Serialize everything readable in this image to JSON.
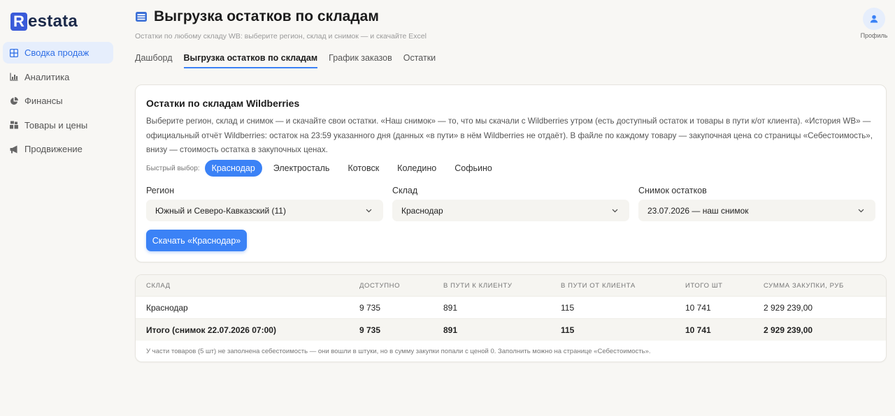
{
  "app": {
    "logo_letter": "R",
    "logo_rest": "estata"
  },
  "sidebar": {
    "items": [
      {
        "label": "Сводка продаж",
        "icon": "grid-icon",
        "active": true
      },
      {
        "label": "Аналитика",
        "icon": "bar-chart-icon",
        "active": false
      },
      {
        "label": "Финансы",
        "icon": "pie-chart-icon",
        "active": false
      },
      {
        "label": "Товары и цены",
        "icon": "boxes-icon",
        "active": false
      },
      {
        "label": "Продвижение",
        "icon": "megaphone-icon",
        "active": false
      }
    ]
  },
  "header": {
    "title": "Выгрузка остатков по складам",
    "subtitle": "Остатки по любому складу WB: выберите регион, склад и снимок — и скачайте Excel",
    "profile_label": "Профиль"
  },
  "tabs": [
    {
      "label": "Дашборд",
      "active": false
    },
    {
      "label": "Выгрузка остатков по складам",
      "active": true
    },
    {
      "label": "График заказов",
      "active": false
    },
    {
      "label": "Остатки",
      "active": false
    }
  ],
  "form": {
    "title": "Остатки по складам Wildberries",
    "description": "Выберите регион, склад и снимок — и скачайте свои остатки. «Наш снимок» — то, что мы скачали с Wildberries утром (есть доступный остаток и товары в пути к/от клиента). «История WB» — официальный отчёт Wildberries: остаток на 23:59 указанного дня (данных «в пути» в нём Wildberries не отдаёт). В файле по каждому товару — закупочная цена со страницы «Себестоимость», внизу — стоимость остатка в закупочных ценах.",
    "quick_label": "Быстрый выбор:",
    "quick_chips": [
      {
        "label": "Краснодар",
        "active": true
      },
      {
        "label": "Электросталь",
        "active": false
      },
      {
        "label": "Котовск",
        "active": false
      },
      {
        "label": "Коледино",
        "active": false
      },
      {
        "label": "Софьино",
        "active": false
      }
    ],
    "region_label": "Регион",
    "region_value": "Южный и Северо-Кавказский (11)",
    "warehouse_label": "Склад",
    "warehouse_value": "Краснодар",
    "snapshot_label": "Снимок остатков",
    "snapshot_value": "23.07.2026 — наш снимок",
    "download_button": "Скачать «Краснодар»"
  },
  "table": {
    "columns": [
      "СКЛАД",
      "ДОСТУПНО",
      "В ПУТИ К КЛИЕНТУ",
      "В ПУТИ ОТ КЛИЕНТА",
      "ИТОГО ШТ",
      "СУММА ЗАКУПКИ, РУБ"
    ],
    "rows": [
      [
        "Краснодар",
        "9 735",
        "891",
        "115",
        "10 741",
        "2 929 239,00"
      ]
    ],
    "total": [
      "Итого (снимок 22.07.2026 07:00)",
      "9 735",
      "891",
      "115",
      "10 741",
      "2 929 239,00"
    ],
    "footnote": "У части товаров (5 шт) не заполнена себестоимость — они вошли в штуки, но в сумму закупки попали с ценой 0. Заполнить можно на странице «Себестоимость»."
  },
  "colors": {
    "accent": "#3b82f6",
    "active_nav_bg": "#e6eefc",
    "brand": "#3a5bd9"
  }
}
